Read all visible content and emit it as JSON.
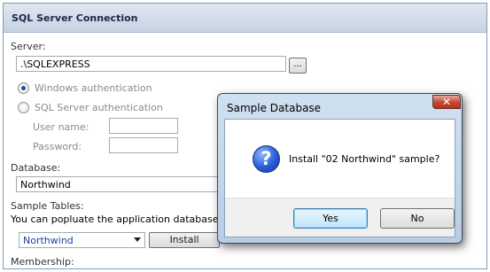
{
  "panel": {
    "title": "SQL Server Connection",
    "server_label": "Server:",
    "server_value": ".\\SQLEXPRESS",
    "browse_label": "...",
    "auth_windows_label": "Windows authentication",
    "auth_sql_label": "SQL Server authentication",
    "selected_auth": "windows",
    "username_label": "User name:",
    "username_value": "",
    "password_label": "Password:",
    "password_value": "",
    "database_label": "Database:",
    "database_value": "Northwind",
    "sample_tables_label": "Sample Tables:",
    "sample_tables_hint": "You can popluate the application database with",
    "sample_selected": "Northwind",
    "install_label": "Install",
    "membership_label": "Membership:"
  },
  "dialog": {
    "title": "Sample Database",
    "message": "Install \"02 Northwind\" sample?",
    "close_glyph": "✕",
    "icon_glyph": "?",
    "yes_label": "Yes",
    "no_label": "No"
  },
  "colors": {
    "header_bg": "#c7d2e2",
    "dialog_frame": "#b8cde4",
    "close_red": "#c24735",
    "icon_blue": "#2a5bd7",
    "accent_text": "#1a3fa0"
  }
}
